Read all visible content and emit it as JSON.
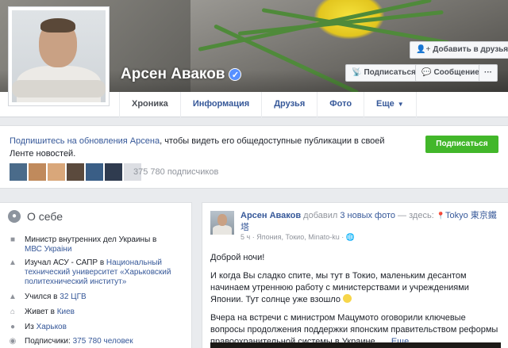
{
  "profile": {
    "name": "Арсен Аваков",
    "verified_mark": "✓"
  },
  "buttons": {
    "add_friend": "Добавить в друзья",
    "add_friend_icon": "👤+",
    "follow": "Подписаться",
    "follow_icon": "📡",
    "message": "Сообщение",
    "message_icon": "💬",
    "more": "···"
  },
  "tabs": [
    {
      "label": "Хроника"
    },
    {
      "label": "Информация"
    },
    {
      "label": "Друзья"
    },
    {
      "label": "Фото"
    },
    {
      "label": "Еще",
      "caret": "▼"
    }
  ],
  "follow_box": {
    "link_text": "Подпишитесь на обновления Арсена",
    "text": ", чтобы видеть его общедоступные публикации в своей Ленте новостей.",
    "button": "Подписаться",
    "count": "375 780 подписчиков",
    "thumb_colors": [
      "#4a6b8a",
      "#c08a5c",
      "#d9a77a",
      "#5b4a3d",
      "#3a5e86",
      "#2f3b4f",
      "#dcdee3"
    ]
  },
  "about": {
    "title": "О себе",
    "items": [
      {
        "icon": "briefcase-icon",
        "glyph": "■",
        "text": "Министр внутренних дел Украины в ",
        "link": "МВС Украіни"
      },
      {
        "icon": "graduation-icon",
        "glyph": "▲",
        "text": "Изучал АСУ - САПР в ",
        "link": "Национальный технический университет «Харьковский политехнический институт»"
      },
      {
        "icon": "school-icon",
        "glyph": "▲",
        "text": "Учился в ",
        "link": "32 ЦГВ"
      },
      {
        "icon": "home-icon",
        "glyph": "⌂",
        "text": "Живет в ",
        "link": "Киев"
      },
      {
        "icon": "location-icon",
        "glyph": "●",
        "text": "Из ",
        "link": "Харьков"
      },
      {
        "icon": "followers-icon",
        "glyph": "◉",
        "text": "Подписчики: ",
        "link": "375 780 человек"
      }
    ]
  },
  "post": {
    "author": "Арсен Аваков",
    "action": " добавил ",
    "photos_link": "3 новых фото",
    "location_prefix": " — здесь: ",
    "location_pin": "📍",
    "location": "Tokyo 東京鐵塔",
    "meta": "5 ч · Япония, Токио, Minato-ku · 🌐",
    "p1": "Доброй ночи!",
    "p2": "И когда Вы сладко спите, мы тут в Токио, маленьким десантом начинаем утреннюю работу с министерствами и учреждениями Японии. Тут солнце уже взошло ",
    "p3": "Вчера на встречи с министром Мацумото оговорили ключевые вопросы продолжения поддержки японским правительством реформы правоохранительной системы в Украине. … ",
    "more": "Еще"
  }
}
